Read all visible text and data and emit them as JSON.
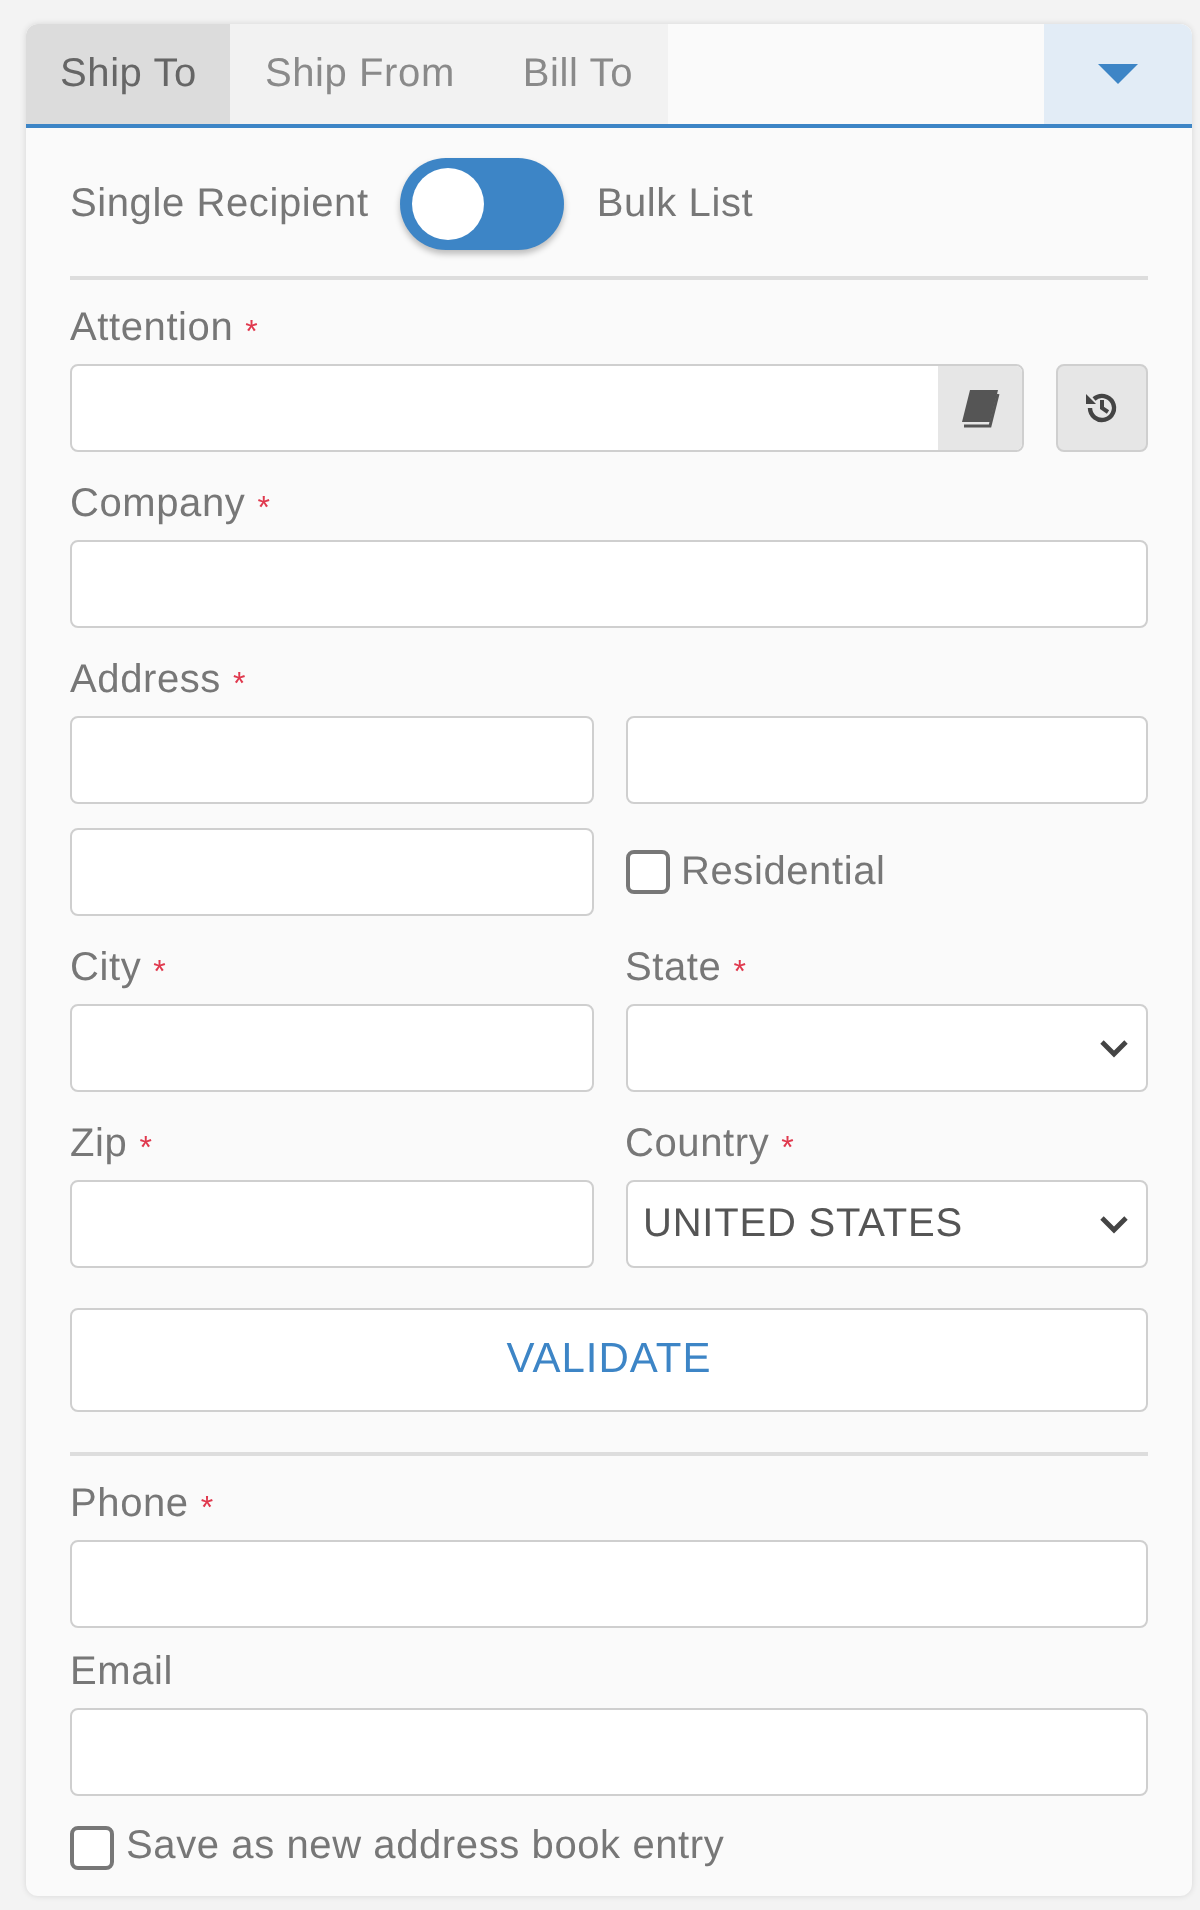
{
  "tabs": [
    {
      "label": "Ship To",
      "selected": true
    },
    {
      "label": "Ship From",
      "selected": false
    },
    {
      "label": "Bill To",
      "selected": false
    }
  ],
  "mode_toggle": {
    "left_label": "Single Recipient",
    "right_label": "Bulk List",
    "on": false
  },
  "attention": {
    "label": "Attention",
    "required_mark": "*"
  },
  "company": {
    "label": "Company",
    "required_mark": "*"
  },
  "address": {
    "label": "Address",
    "required_mark": "*",
    "residential": {
      "label": "Residential",
      "checked": false
    }
  },
  "city": {
    "label": "City",
    "required_mark": "*"
  },
  "state": {
    "label": "State",
    "required_mark": "*"
  },
  "zip": {
    "label": "Zip",
    "required_mark": "*"
  },
  "country": {
    "label": "Country",
    "required_mark": "*",
    "value": "UNITED STATES"
  },
  "validate_button": "VALIDATE",
  "phone": {
    "label": "Phone",
    "required_mark": "*"
  },
  "email": {
    "label": "Email"
  },
  "save_entry": {
    "label": "Save as new address book entry",
    "checked": false
  }
}
